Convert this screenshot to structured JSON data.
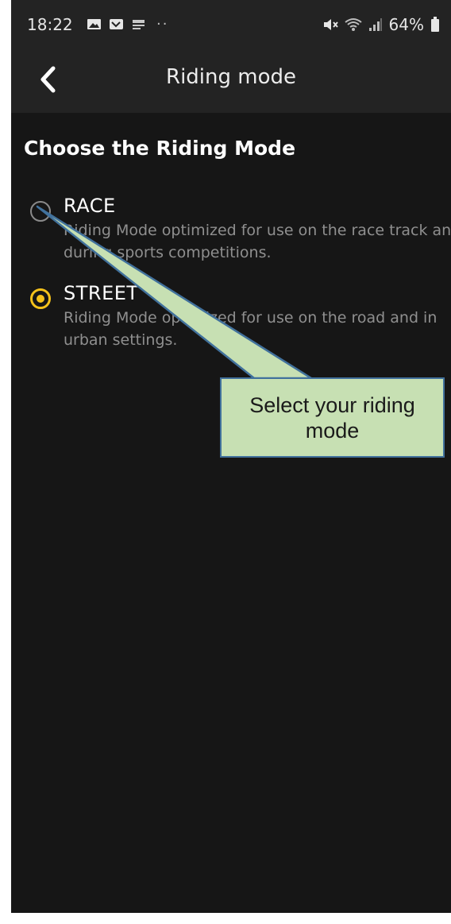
{
  "status_bar": {
    "time": "18:22",
    "dots": "··",
    "battery": "64%",
    "icons": [
      "gallery-icon",
      "notification-app-icon",
      "news-icon",
      "mute-icon",
      "wifi-icon",
      "signal-icon",
      "battery-icon"
    ]
  },
  "app_bar": {
    "back_icon": "chevron-left-icon",
    "title": "Riding mode"
  },
  "content": {
    "section_title": "Choose the Riding Mode",
    "options": [
      {
        "label": "RACE",
        "description": "Riding Mode optimized for use on the race track and during sports competitions.",
        "selected": false
      },
      {
        "label": "STREET",
        "description": "Riding Mode optimized for use on the road and in urban settings.",
        "selected": true
      }
    ]
  },
  "annotation": {
    "callout_text": "Select your riding mode"
  },
  "colors": {
    "background": "#161616",
    "bar": "#232323",
    "accent_yellow": "#f5c21b",
    "callout_fill": "#c7e0b3",
    "callout_border": "#41719c"
  }
}
